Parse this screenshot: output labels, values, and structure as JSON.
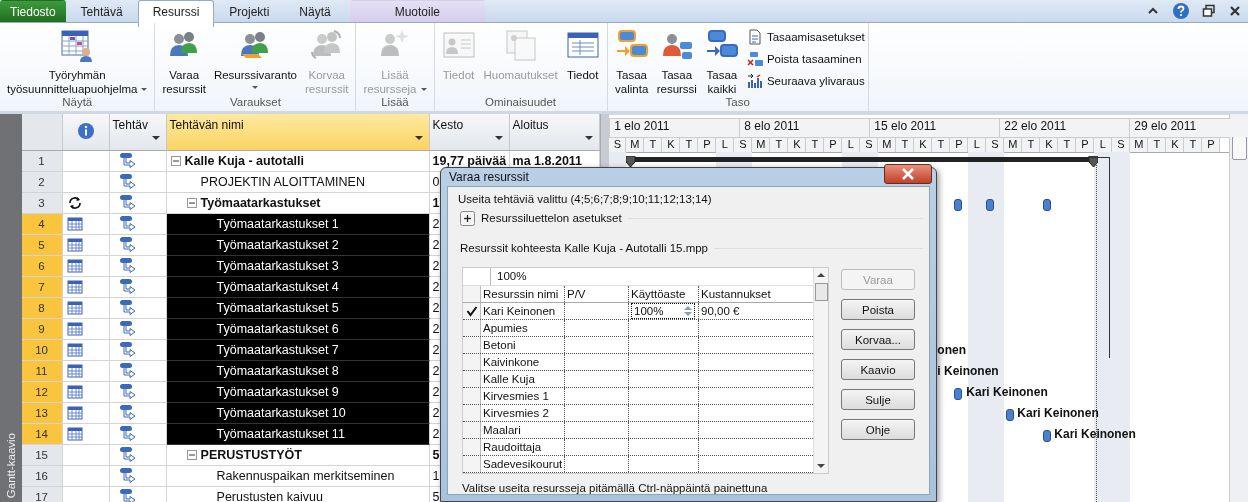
{
  "ribbon": {
    "tabs": [
      {
        "label": "Tiedosto",
        "kind": "file",
        "selected": false
      },
      {
        "label": "Tehtävä",
        "kind": "normal",
        "selected": false
      },
      {
        "label": "Resurssi",
        "kind": "normal",
        "selected": true
      },
      {
        "label": "Projekti",
        "kind": "normal",
        "selected": false
      },
      {
        "label": "Näytä",
        "kind": "normal",
        "selected": false
      },
      {
        "label": "Muotoile",
        "kind": "contextual",
        "selected": false
      }
    ],
    "groups": [
      {
        "label": "Näytä",
        "buttons": [
          {
            "kind": "large",
            "lines": [
              "Työryhmän",
              "työsuunnitteluapuohjelma"
            ],
            "dropdown": true,
            "disabled": false
          }
        ]
      },
      {
        "label": "Varaukset",
        "buttons": [
          {
            "kind": "large",
            "lines": [
              "Varaa",
              "resurssit"
            ],
            "dropdown": false,
            "disabled": false
          },
          {
            "kind": "large",
            "lines": [
              "Resurssivaranto"
            ],
            "dropdown": true,
            "disabled": false
          },
          {
            "kind": "large",
            "lines": [
              "Korvaa",
              "resurssit"
            ],
            "dropdown": false,
            "disabled": true
          }
        ]
      },
      {
        "label": "Lisää",
        "buttons": [
          {
            "kind": "large",
            "lines": [
              "Lisää",
              "resursseja"
            ],
            "dropdown": true,
            "disabled": true
          }
        ]
      },
      {
        "label": "Ominaisuudet",
        "buttons": [
          {
            "kind": "large",
            "lines": [
              "Tiedot"
            ],
            "dropdown": false,
            "disabled": true
          },
          {
            "kind": "large",
            "lines": [
              "Huomautukset"
            ],
            "dropdown": false,
            "disabled": true
          },
          {
            "kind": "large",
            "lines": [
              "Tiedot"
            ],
            "dropdown": false,
            "disabled": false
          }
        ]
      },
      {
        "label": "Taso",
        "buttons": [
          {
            "kind": "large",
            "lines": [
              "Tasaa",
              "valinta"
            ],
            "dropdown": false,
            "disabled": false
          },
          {
            "kind": "large",
            "lines": [
              "Tasaa",
              "resurssi"
            ],
            "dropdown": false,
            "disabled": false
          },
          {
            "kind": "large",
            "lines": [
              "Tasaa",
              "kaikki"
            ],
            "dropdown": false,
            "disabled": false
          },
          {
            "kind": "small",
            "lines": [
              "Tasaamisasetukset"
            ],
            "disabled": false
          },
          {
            "kind": "small",
            "lines": [
              "Poista tasaaminen"
            ],
            "disabled": false
          },
          {
            "kind": "small",
            "lines": [
              "Seuraava ylivaraus"
            ],
            "disabled": false
          }
        ]
      }
    ]
  },
  "view_label": "Gantt-kaavio",
  "columns": [
    {
      "label": "Tehtäv",
      "highlighted": false
    },
    {
      "label": "Tehtävän nimi",
      "highlighted": true
    },
    {
      "label": "Kesto",
      "highlighted": false
    },
    {
      "label": "Aloitus",
      "highlighted": false
    }
  ],
  "rows": [
    {
      "id": "1",
      "name": "Kalle Kuja - autotalli",
      "duration": "19,77 päivää",
      "start": "ma 1.8.2011",
      "selected": false,
      "expanded": true,
      "children": [
        {
          "id": "2",
          "name": "PROJEKTIN ALOITTAMINEN",
          "duration": "0",
          "selected": false
        },
        {
          "id": "3",
          "kind": "recurring",
          "name": "Työmaatarkastukset",
          "duration": "1",
          "selected": false,
          "expanded": true,
          "children": [
            {
              "id": "4",
              "kind": "calendar",
              "name": "Työmaatarkastukset 1",
              "duration": "2",
              "selected": true
            },
            {
              "id": "5",
              "kind": "calendar",
              "name": "Työmaatarkastukset 2",
              "duration": "2",
              "selected": true
            },
            {
              "id": "6",
              "kind": "calendar",
              "name": "Työmaatarkastukset 3",
              "duration": "2",
              "selected": true
            },
            {
              "id": "7",
              "kind": "calendar",
              "name": "Työmaatarkastukset 4",
              "duration": "2",
              "selected": true
            },
            {
              "id": "8",
              "kind": "calendar",
              "name": "Työmaatarkastukset 5",
              "duration": "2",
              "selected": true
            },
            {
              "id": "9",
              "kind": "calendar",
              "name": "Työmaatarkastukset 6",
              "duration": "2",
              "selected": true
            },
            {
              "id": "10",
              "kind": "calendar",
              "name": "Työmaatarkastukset 7",
              "duration": "2",
              "selected": true,
              "bar_label": "onen"
            },
            {
              "id": "11",
              "kind": "calendar",
              "name": "Työmaatarkastukset 8",
              "duration": "2",
              "selected": true,
              "bar_label": "i Keinonen"
            },
            {
              "id": "12",
              "kind": "calendar",
              "name": "Työmaatarkastukset 9",
              "duration": "2",
              "selected": true,
              "bar_label": "Kari Keinonen"
            },
            {
              "id": "13",
              "kind": "calendar",
              "name": "Työmaatarkastukset 10",
              "duration": "2",
              "selected": true,
              "bar_label": "Kari Keinonen"
            },
            {
              "id": "14",
              "kind": "calendar",
              "name": "Työmaatarkastukset 11",
              "duration": "2",
              "selected": true,
              "bar_label": "Kari Keinonen"
            }
          ]
        },
        {
          "id": "15",
          "name": "PERUSTUSTYÖT",
          "duration": "5",
          "selected": false,
          "expanded": true,
          "children": [
            {
              "id": "16",
              "name": "Rakennuspaikan merkitseminen",
              "duration": "1",
              "selected": false
            },
            {
              "id": "17",
              "name": "Perustusten kaivuu",
              "duration": "5",
              "selected": false
            }
          ]
        }
      ]
    }
  ],
  "gantt": {
    "weeks": [
      "1 elo 2011",
      "8 elo 2011",
      "15 elo 2011",
      "22 elo 2011",
      "29 elo 2011"
    ],
    "days": [
      "S",
      "M",
      "T",
      "K",
      "T",
      "P",
      "L",
      "S",
      "M",
      "T",
      "K",
      "T",
      "P",
      "L",
      "S",
      "M",
      "T",
      "K",
      "T",
      "P",
      "L",
      "S",
      "M",
      "T",
      "K",
      "T",
      "P",
      "L",
      "S",
      "M",
      "T",
      "K",
      "T",
      "P"
    ]
  },
  "dialog": {
    "title": "Varaa resurssit",
    "info": "Useita tehtäviä valittu (4;5;6;7;8;9;10;11;12;13;14)",
    "options_label": "Resurssiluettelon asetukset",
    "options_expanded": false,
    "source_label": "Resurssit kohteesta Kalle Kuja - Autotalli 15.mpp",
    "entry_value": "100%",
    "columns": [
      "Resurssin nimi",
      "P/V",
      "Käyttöaste",
      "Kustannukset"
    ],
    "resources": [
      {
        "name": "Kari Keinonen",
        "checked": true,
        "units": "100%",
        "cost": "90,00 €"
      },
      {
        "name": "Apumies",
        "checked": false
      },
      {
        "name": "Betoni",
        "checked": false
      },
      {
        "name": "Kaivinkone",
        "checked": false
      },
      {
        "name": "Kalle Kuja",
        "checked": false
      },
      {
        "name": "Kirvesmies 1",
        "checked": false
      },
      {
        "name": "Kirvesmies 2",
        "checked": false
      },
      {
        "name": "Maalari",
        "checked": false
      },
      {
        "name": "Raudoittaja",
        "checked": false
      },
      {
        "name": "Sadevesikourut",
        "checked": false
      }
    ],
    "buttons": [
      {
        "label": "Varaa",
        "disabled": true
      },
      {
        "label": "Poista",
        "disabled": false
      },
      {
        "label": "Korvaa...",
        "disabled": false
      },
      {
        "label": "Kaavio",
        "disabled": false
      },
      {
        "label": "Sulje",
        "disabled": false
      },
      {
        "label": "Ohje",
        "disabled": false
      }
    ],
    "hint": "Valitse useita resursseja pitämällä Ctrl-näppäintä painettuna"
  }
}
